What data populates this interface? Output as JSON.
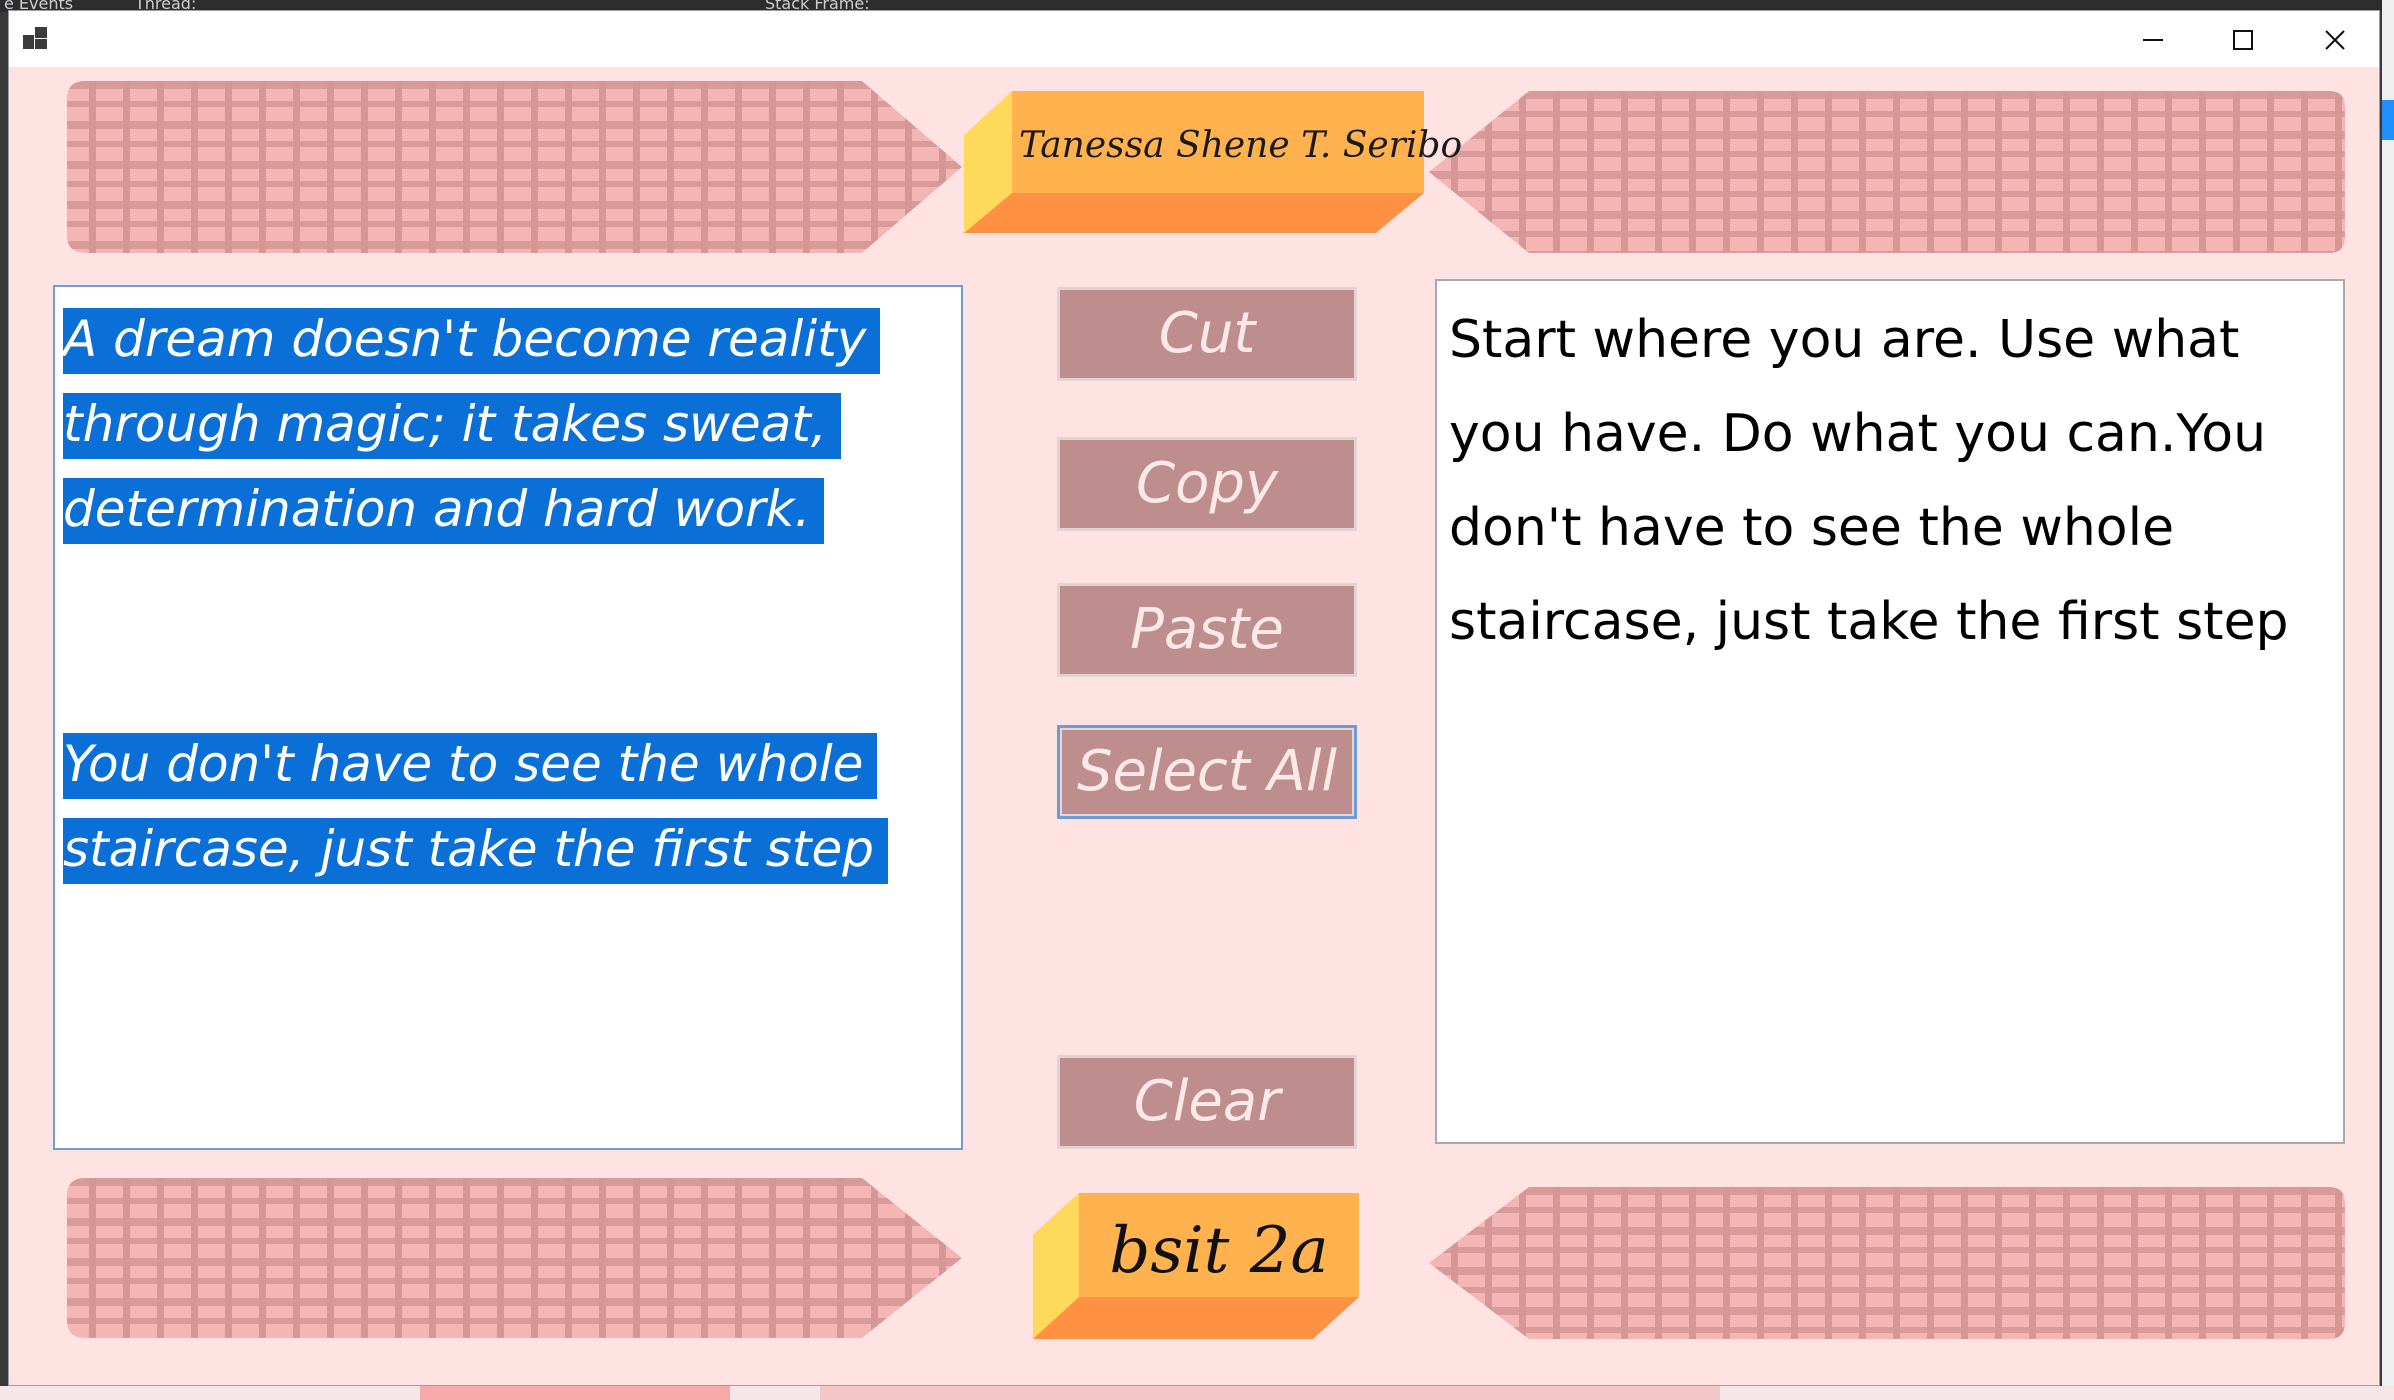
{
  "window": {
    "author_name": "Tanessa Shene T. Seribo",
    "section_label": "bsit 2a",
    "controls": {
      "minimize": "minimize-icon",
      "maximize": "maximize-icon",
      "close": "close-icon"
    }
  },
  "background": {
    "top_texts": [
      "e Events",
      "Thread:",
      "Stack Frame:"
    ]
  },
  "left_textbox": {
    "paragraph1": "A dream doesn't become reality through magic; it takes sweat, determination and hard work.",
    "paragraph2": "You don't have to see the whole staircase, just take the first step",
    "selected": true
  },
  "right_textbox": {
    "text": "Start where you are. Use what you have. Do what you can.You don't have to see the whole staircase, just take the first step"
  },
  "buttons": {
    "cut": "Cut",
    "copy": "Copy",
    "paste": "Paste",
    "select_all": "Select All",
    "clear": "Clear"
  },
  "colors": {
    "form_background": "#ffe3e2",
    "button_fill": "#be8d8e",
    "button_text": "#fde9e7",
    "selection": "#0a6fd6",
    "plaid_fill": "#f4b6b4",
    "plaid_lines": "#d99898",
    "tag_orange": "#ffb347",
    "tag_dark": "#ff9142",
    "tag_yellow": "#ffd95a"
  }
}
